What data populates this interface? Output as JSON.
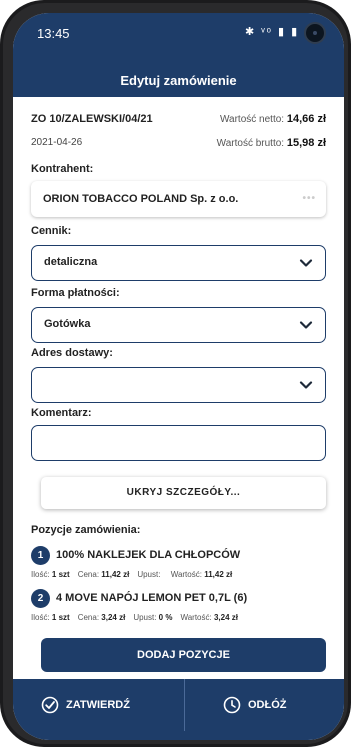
{
  "status": {
    "time": "13:45",
    "icons": "✱ ᵛᵒ ▮ ▮"
  },
  "title": "Edytuj zamówienie",
  "order": {
    "number": "ZO 10/ZALEWSKI/04/21",
    "date": "2021-04-26",
    "net_label": "Wartość netto:",
    "net_value": "14,66 zł",
    "gross_label": "Wartość brutto:",
    "gross_value": "15,98 zł"
  },
  "contractor": {
    "label": "Kontrahent:",
    "value": "ORION TOBACCO POLAND Sp. z o.o.",
    "more": "•••"
  },
  "price_list": {
    "label": "Cennik:",
    "value": "detaliczna"
  },
  "payment": {
    "label": "Forma płatności:",
    "value": "Gotówka"
  },
  "delivery": {
    "label": "Adres dostawy:",
    "value": ""
  },
  "comment": {
    "label": "Komentarz:",
    "value": ""
  },
  "hide_details_label": "UKRYJ SZCZEGÓŁY...",
  "positions": {
    "label": "Pozycje zamówienia:",
    "items": [
      {
        "num": "1",
        "name": "100% NAKLEJEK DLA CHŁOPCÓW",
        "qty_label": "Ilość:",
        "qty": "1 szt",
        "price_label": "Cena:",
        "price": "11,42 zł",
        "discount_label": "Upust:",
        "discount": "",
        "value_label": "Wartość:",
        "value": "11,42 zł"
      },
      {
        "num": "2",
        "name": "4 MOVE NAPÓJ LEMON PET 0,7L (6)",
        "qty_label": "Ilość:",
        "qty": "1 szt",
        "price_label": "Cena:",
        "price": "3,24 zł",
        "discount_label": "Upust:",
        "discount": "0 %",
        "value_label": "Wartość:",
        "value": "3,24 zł"
      }
    ]
  },
  "add_position_label": "DODAJ POZYCJE",
  "bottom": {
    "confirm_label": "ZATWIERDŹ",
    "postpone_label": "ODŁÓŻ"
  },
  "colors": {
    "primary": "#1e3d69",
    "background": "#ffffff"
  }
}
